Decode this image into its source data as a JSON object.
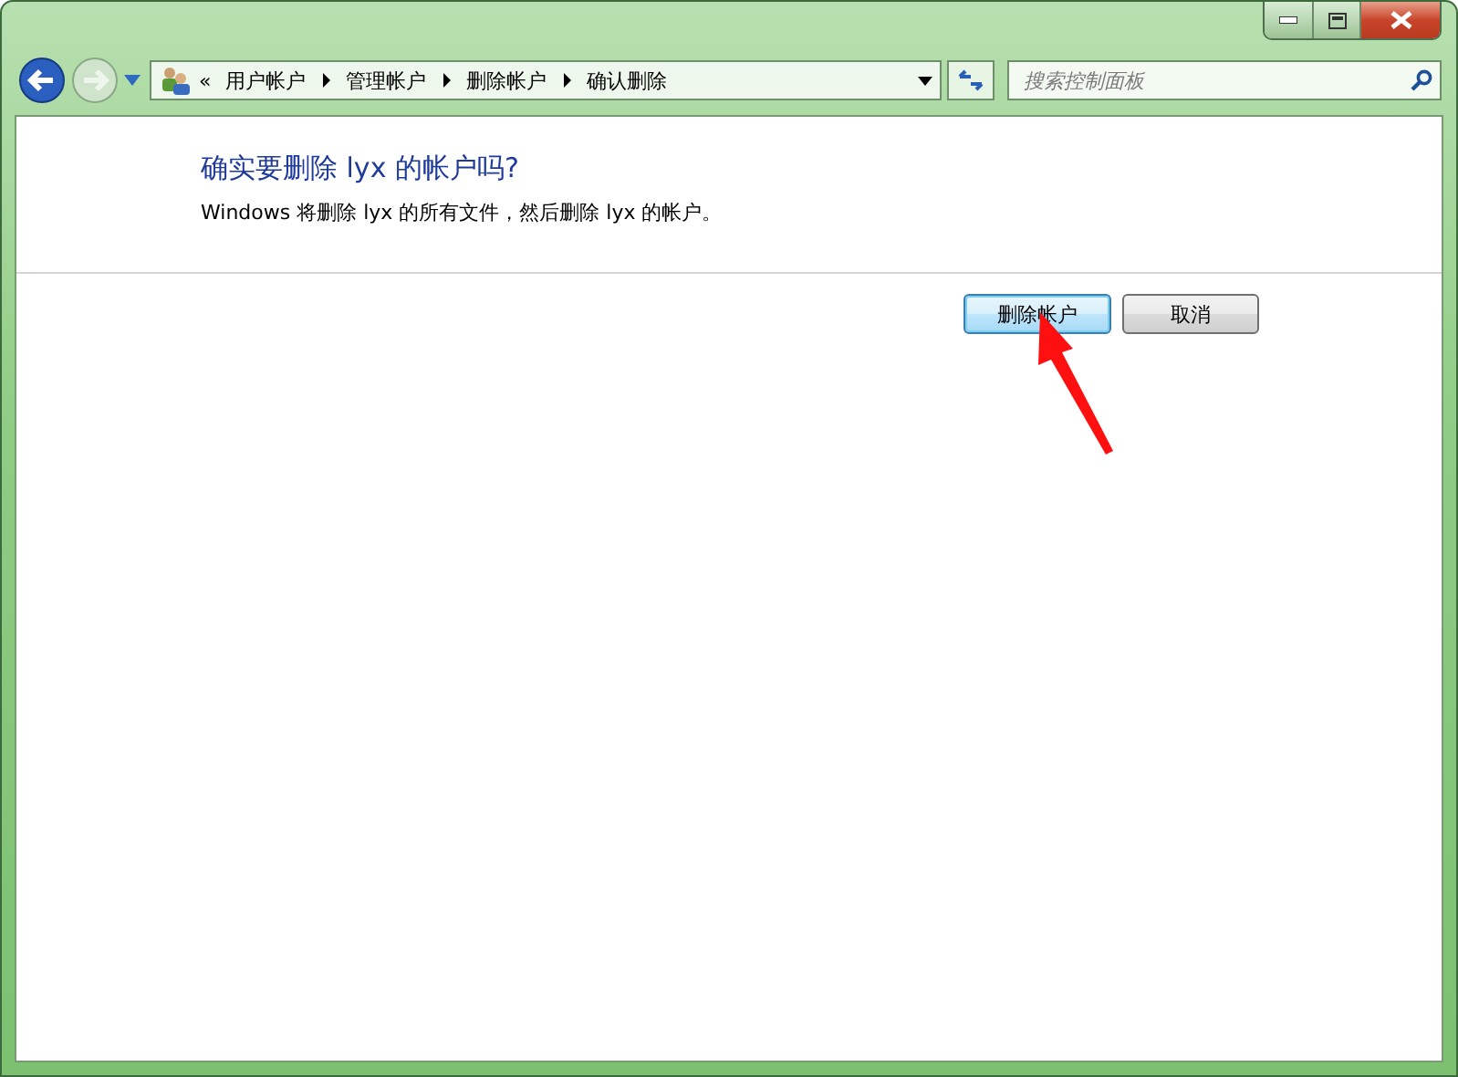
{
  "window": {
    "controls": [
      {
        "kind": "minimize"
      },
      {
        "kind": "maximize"
      },
      {
        "kind": "close"
      }
    ]
  },
  "address_bar": {
    "overflow": "«",
    "breadcrumbs": [
      "用户帐户",
      "管理帐户",
      "删除帐户",
      "确认删除"
    ]
  },
  "search": {
    "placeholder": "搜索控制面板"
  },
  "content": {
    "heading": "确实要删除 lyx 的帐户吗?",
    "description": "Windows 将删除 lyx 的所有文件，然后删除 lyx 的帐户。"
  },
  "buttons": [
    {
      "label": "删除帐户",
      "default": true
    },
    {
      "label": "取消",
      "default": false
    }
  ]
}
